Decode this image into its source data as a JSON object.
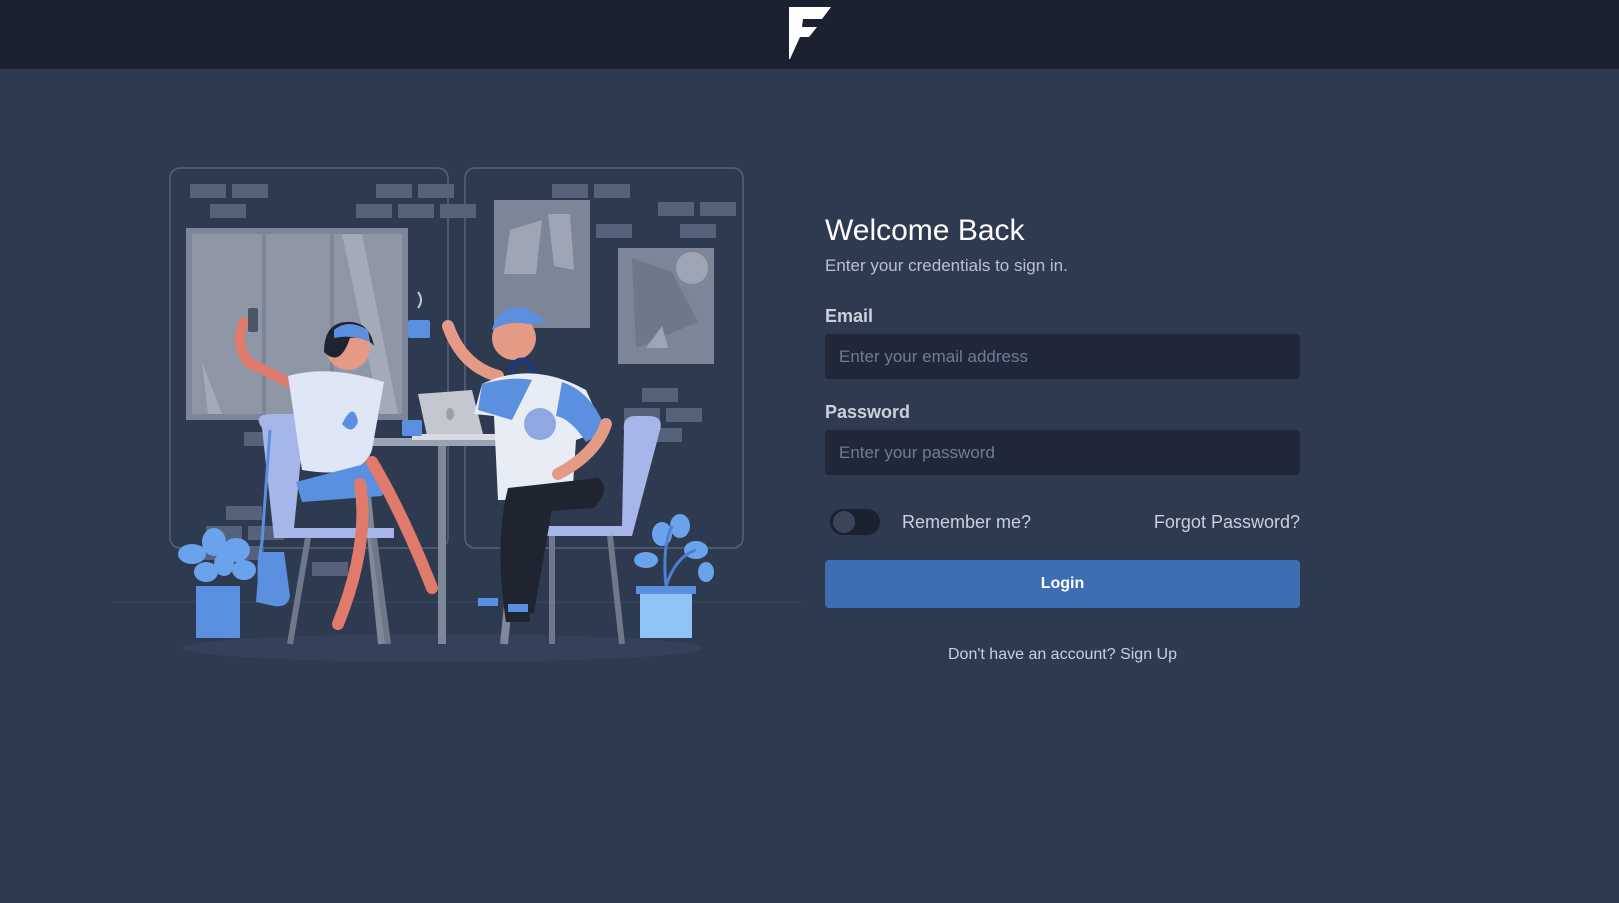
{
  "header": {
    "logo_icon": "f-logo-icon"
  },
  "illustration": {
    "icon": "couple-selfie-illustration"
  },
  "login": {
    "title": "Welcome Back",
    "subtitle": "Enter your credentials to sign in.",
    "email_label": "Email",
    "email_placeholder": "Enter your email address",
    "email_value": "",
    "password_label": "Password",
    "password_placeholder": "Enter your password",
    "password_value": "",
    "remember_label": "Remember me?",
    "remember_checked": false,
    "forgot_label": "Forgot Password?",
    "login_button": "Login",
    "signup_prompt": "Don't have an account?",
    "signup_link": "Sign Up"
  },
  "colors": {
    "background": "#2e3a50",
    "topbar": "#1b2130",
    "accent": "#3f6db3",
    "input_bg": "#1f2738"
  }
}
